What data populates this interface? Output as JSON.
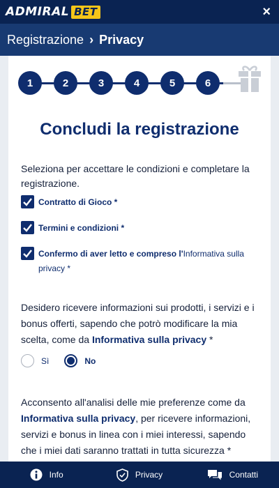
{
  "header": {
    "logo_left": "ADMIRAL",
    "logo_right": "BET",
    "close_glyph": "×"
  },
  "breadcrumb": {
    "parent": "Registrazione",
    "separator": "›",
    "current": "Privacy"
  },
  "stepper": {
    "steps": [
      "1",
      "2",
      "3",
      "4",
      "5",
      "6"
    ],
    "final_icon": "gift-icon"
  },
  "title": "Concludi la registrazione",
  "intro": "Seleziona per accettare le condizioni e completare la registrazione.",
  "checkboxes": [
    {
      "label": "Contratto di Gioco *",
      "checked": true
    },
    {
      "label": "Termini e condizioni *",
      "checked": true
    },
    {
      "label_pre": "Confermo di aver letto e compreso l'",
      "link": "Informativa sulla privacy",
      "label_post": " *",
      "checked": true
    }
  ],
  "marketing": {
    "text_pre": "Desidero ricevere informazioni sui prodotti, i servizi e i bonus offerti, sapendo che potrò modificare la mia scelta, come da ",
    "link": "Informativa sulla privacy",
    "text_post": " *",
    "options": [
      {
        "label": "Sì",
        "selected": false
      },
      {
        "label": "No",
        "selected": true
      }
    ]
  },
  "profiling": {
    "text_pre": "Acconsento all'analisi delle mie preferenze come da ",
    "link": "Informativa sulla privacy",
    "text_post": ", per ricevere informazioni, servizi e bonus in linea con i miei interessi, sapendo che i miei dati saranno trattati in tutta sicurezza *"
  },
  "bottom_nav": [
    {
      "label": "Info",
      "icon": "info-icon"
    },
    {
      "label": "Privacy",
      "icon": "shield-icon"
    },
    {
      "label": "Contatti",
      "icon": "chat-icon"
    }
  ],
  "colors": {
    "navy": "#0a2352",
    "brand_blue": "#0f2d6e",
    "accent_yellow": "#f5c518"
  }
}
